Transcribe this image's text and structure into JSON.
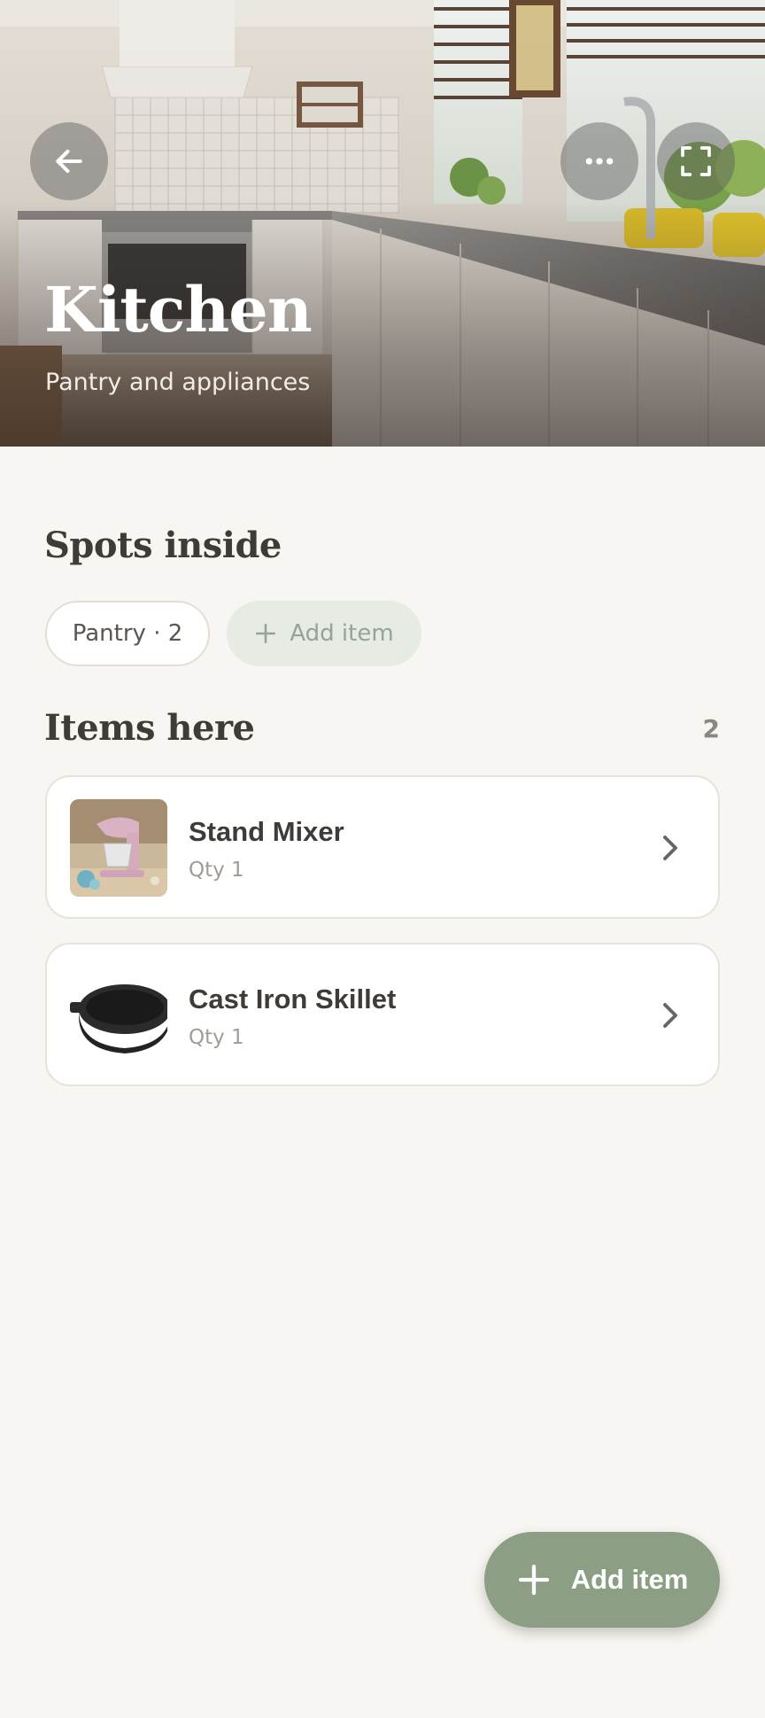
{
  "hero": {
    "title": "Kitchen",
    "subtitle": "Pantry and appliances",
    "back_icon": "arrow-left-icon",
    "more_icon": "more-horizontal-icon",
    "expand_icon": "fullscreen-icon"
  },
  "spots": {
    "title": "Spots inside",
    "chips": [
      {
        "label": "Pantry · 2"
      },
      {
        "label": "Add item",
        "icon": "plus-icon"
      }
    ]
  },
  "items": {
    "title": "Items here",
    "count": "2",
    "list": [
      {
        "name": "Stand Mixer",
        "qty": "Qty 1",
        "thumb": "stand-mixer-photo"
      },
      {
        "name": "Cast Iron Skillet",
        "qty": "Qty 1",
        "thumb": "cast-iron-skillet-photo"
      }
    ]
  },
  "fab": {
    "label": "Add item",
    "icon": "plus-icon"
  },
  "colors": {
    "background": "#f8f6f2",
    "accent": "#8c9e84",
    "chip_add_bg": "#e6ebe3",
    "text_primary": "#3f3b37",
    "text_muted": "#a19b95"
  }
}
